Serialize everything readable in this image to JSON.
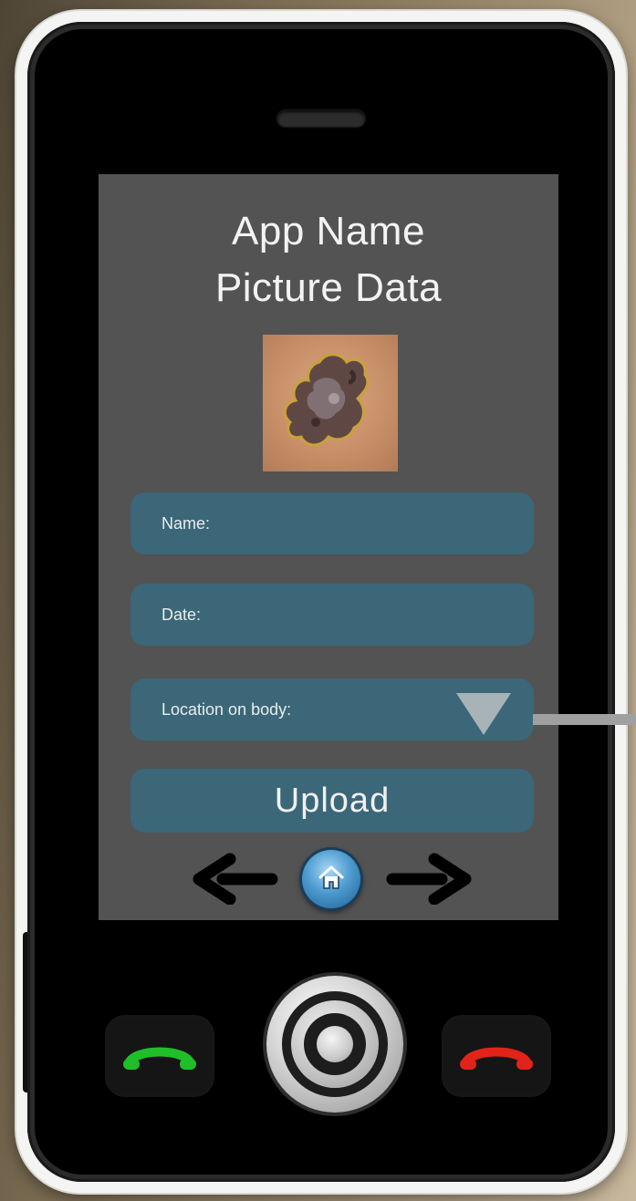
{
  "app": {
    "title_line1": "App Name",
    "title_line2": "Picture Data"
  },
  "form": {
    "name_label": "Name:",
    "date_label": "Date:",
    "location_label": "Location on body:",
    "upload_label": "Upload"
  },
  "icons": {
    "back": "left-arrow-icon",
    "home": "home-icon",
    "forward": "right-arrow-icon",
    "dropdown": "triangle-down-icon",
    "call": "phone-green-icon",
    "end_call": "phone-red-icon"
  },
  "colors": {
    "screen_bg": "#535353",
    "field_bg": "#3b6779",
    "call_green": "#1fbf2a",
    "end_red": "#e2231a"
  }
}
